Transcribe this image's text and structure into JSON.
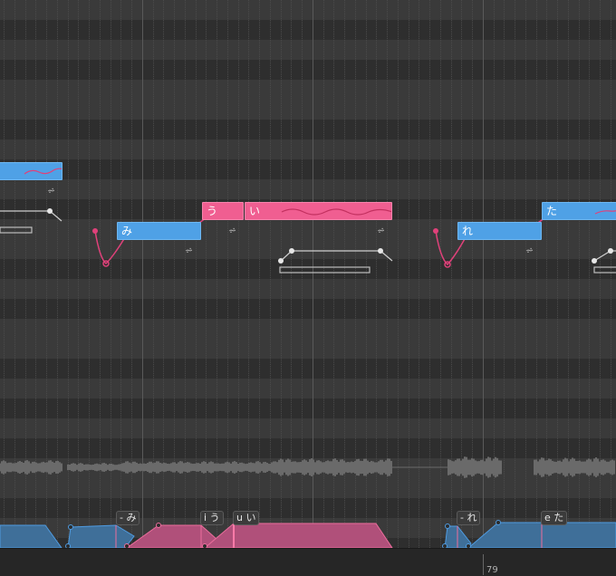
{
  "colors": {
    "blue_note": "#4fa1e6",
    "pink_note": "#f05e91",
    "pitch_curve": "#e0417a",
    "row_light": "#3a3a3a",
    "row_dark": "#2e2e2e",
    "waveform": "#6a6a6a"
  },
  "notes": [
    {
      "lyric": "",
      "color": "blue"
    },
    {
      "lyric": "み",
      "color": "blue"
    },
    {
      "lyric": "う",
      "color": "pink"
    },
    {
      "lyric": "い",
      "color": "pink"
    },
    {
      "lyric": "れ",
      "color": "blue"
    },
    {
      "lyric": "た",
      "color": "blue"
    }
  ],
  "vibrato_icon": "vibrato-icon",
  "vibrato_glyph": "⩫",
  "phonemes": [
    {
      "label": "- み"
    },
    {
      "label": "i う"
    },
    {
      "label": "u い"
    },
    {
      "label": "- れ"
    },
    {
      "label": "e た"
    }
  ],
  "ruler": {
    "bar_number": "79"
  }
}
